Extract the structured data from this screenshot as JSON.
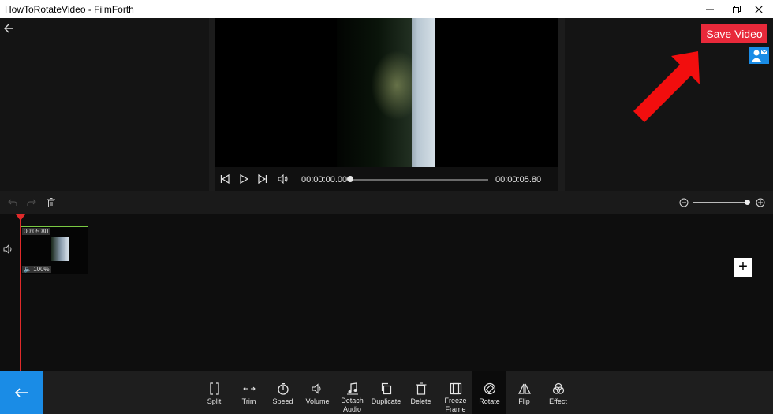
{
  "window": {
    "title": "HowToRotateVideo - FilmForth"
  },
  "header": {
    "save_label": "Save Video"
  },
  "player": {
    "current_time": "00:00:00.00",
    "end_time": "00:00:05.80"
  },
  "clip": {
    "duration": "00:05.80",
    "volume": "100%"
  },
  "toolbar": {
    "items": [
      {
        "label": "Split",
        "icon": "split-icon"
      },
      {
        "label": "Trim",
        "icon": "trim-icon"
      },
      {
        "label": "Speed",
        "icon": "speed-icon"
      },
      {
        "label": "Volume",
        "icon": "volume-icon"
      },
      {
        "label": "Detach Audio",
        "icon": "detach-audio-icon"
      },
      {
        "label": "Duplicate",
        "icon": "duplicate-icon"
      },
      {
        "label": "Delete",
        "icon": "delete-icon"
      },
      {
        "label": "Freeze Frame",
        "icon": "freeze-frame-icon"
      },
      {
        "label": "Rotate",
        "icon": "rotate-icon"
      },
      {
        "label": "Flip",
        "icon": "flip-icon"
      },
      {
        "label": "Effect",
        "icon": "effect-icon"
      }
    ]
  },
  "colors": {
    "accent": "#1a8ce6",
    "save": "#e8293a",
    "playhead": "#e02a2a",
    "clip_border": "#7ac943"
  }
}
